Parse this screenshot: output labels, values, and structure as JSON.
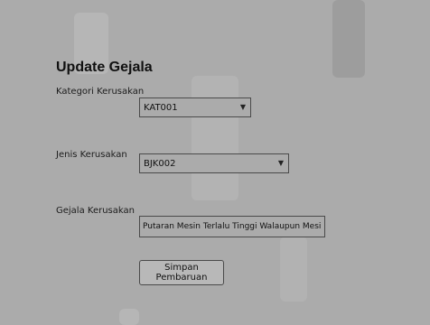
{
  "form": {
    "title": "Update Gejala",
    "kategori": {
      "label": "Kategori Kerusakan",
      "selected": "KAT001"
    },
    "jenis": {
      "label": "Jenis Kerusakan",
      "selected": "BJK002"
    },
    "gejala": {
      "label": "Gejala Kerusakan",
      "value": "Putaran Mesin Terlalu Tinggi Walaupun Mesin Tidak DiG"
    },
    "submit_label": "Simpan Pembaruan"
  },
  "icons": {
    "dropdown": "chevron-down-icon"
  },
  "colors": {
    "background": "#ababab"
  }
}
